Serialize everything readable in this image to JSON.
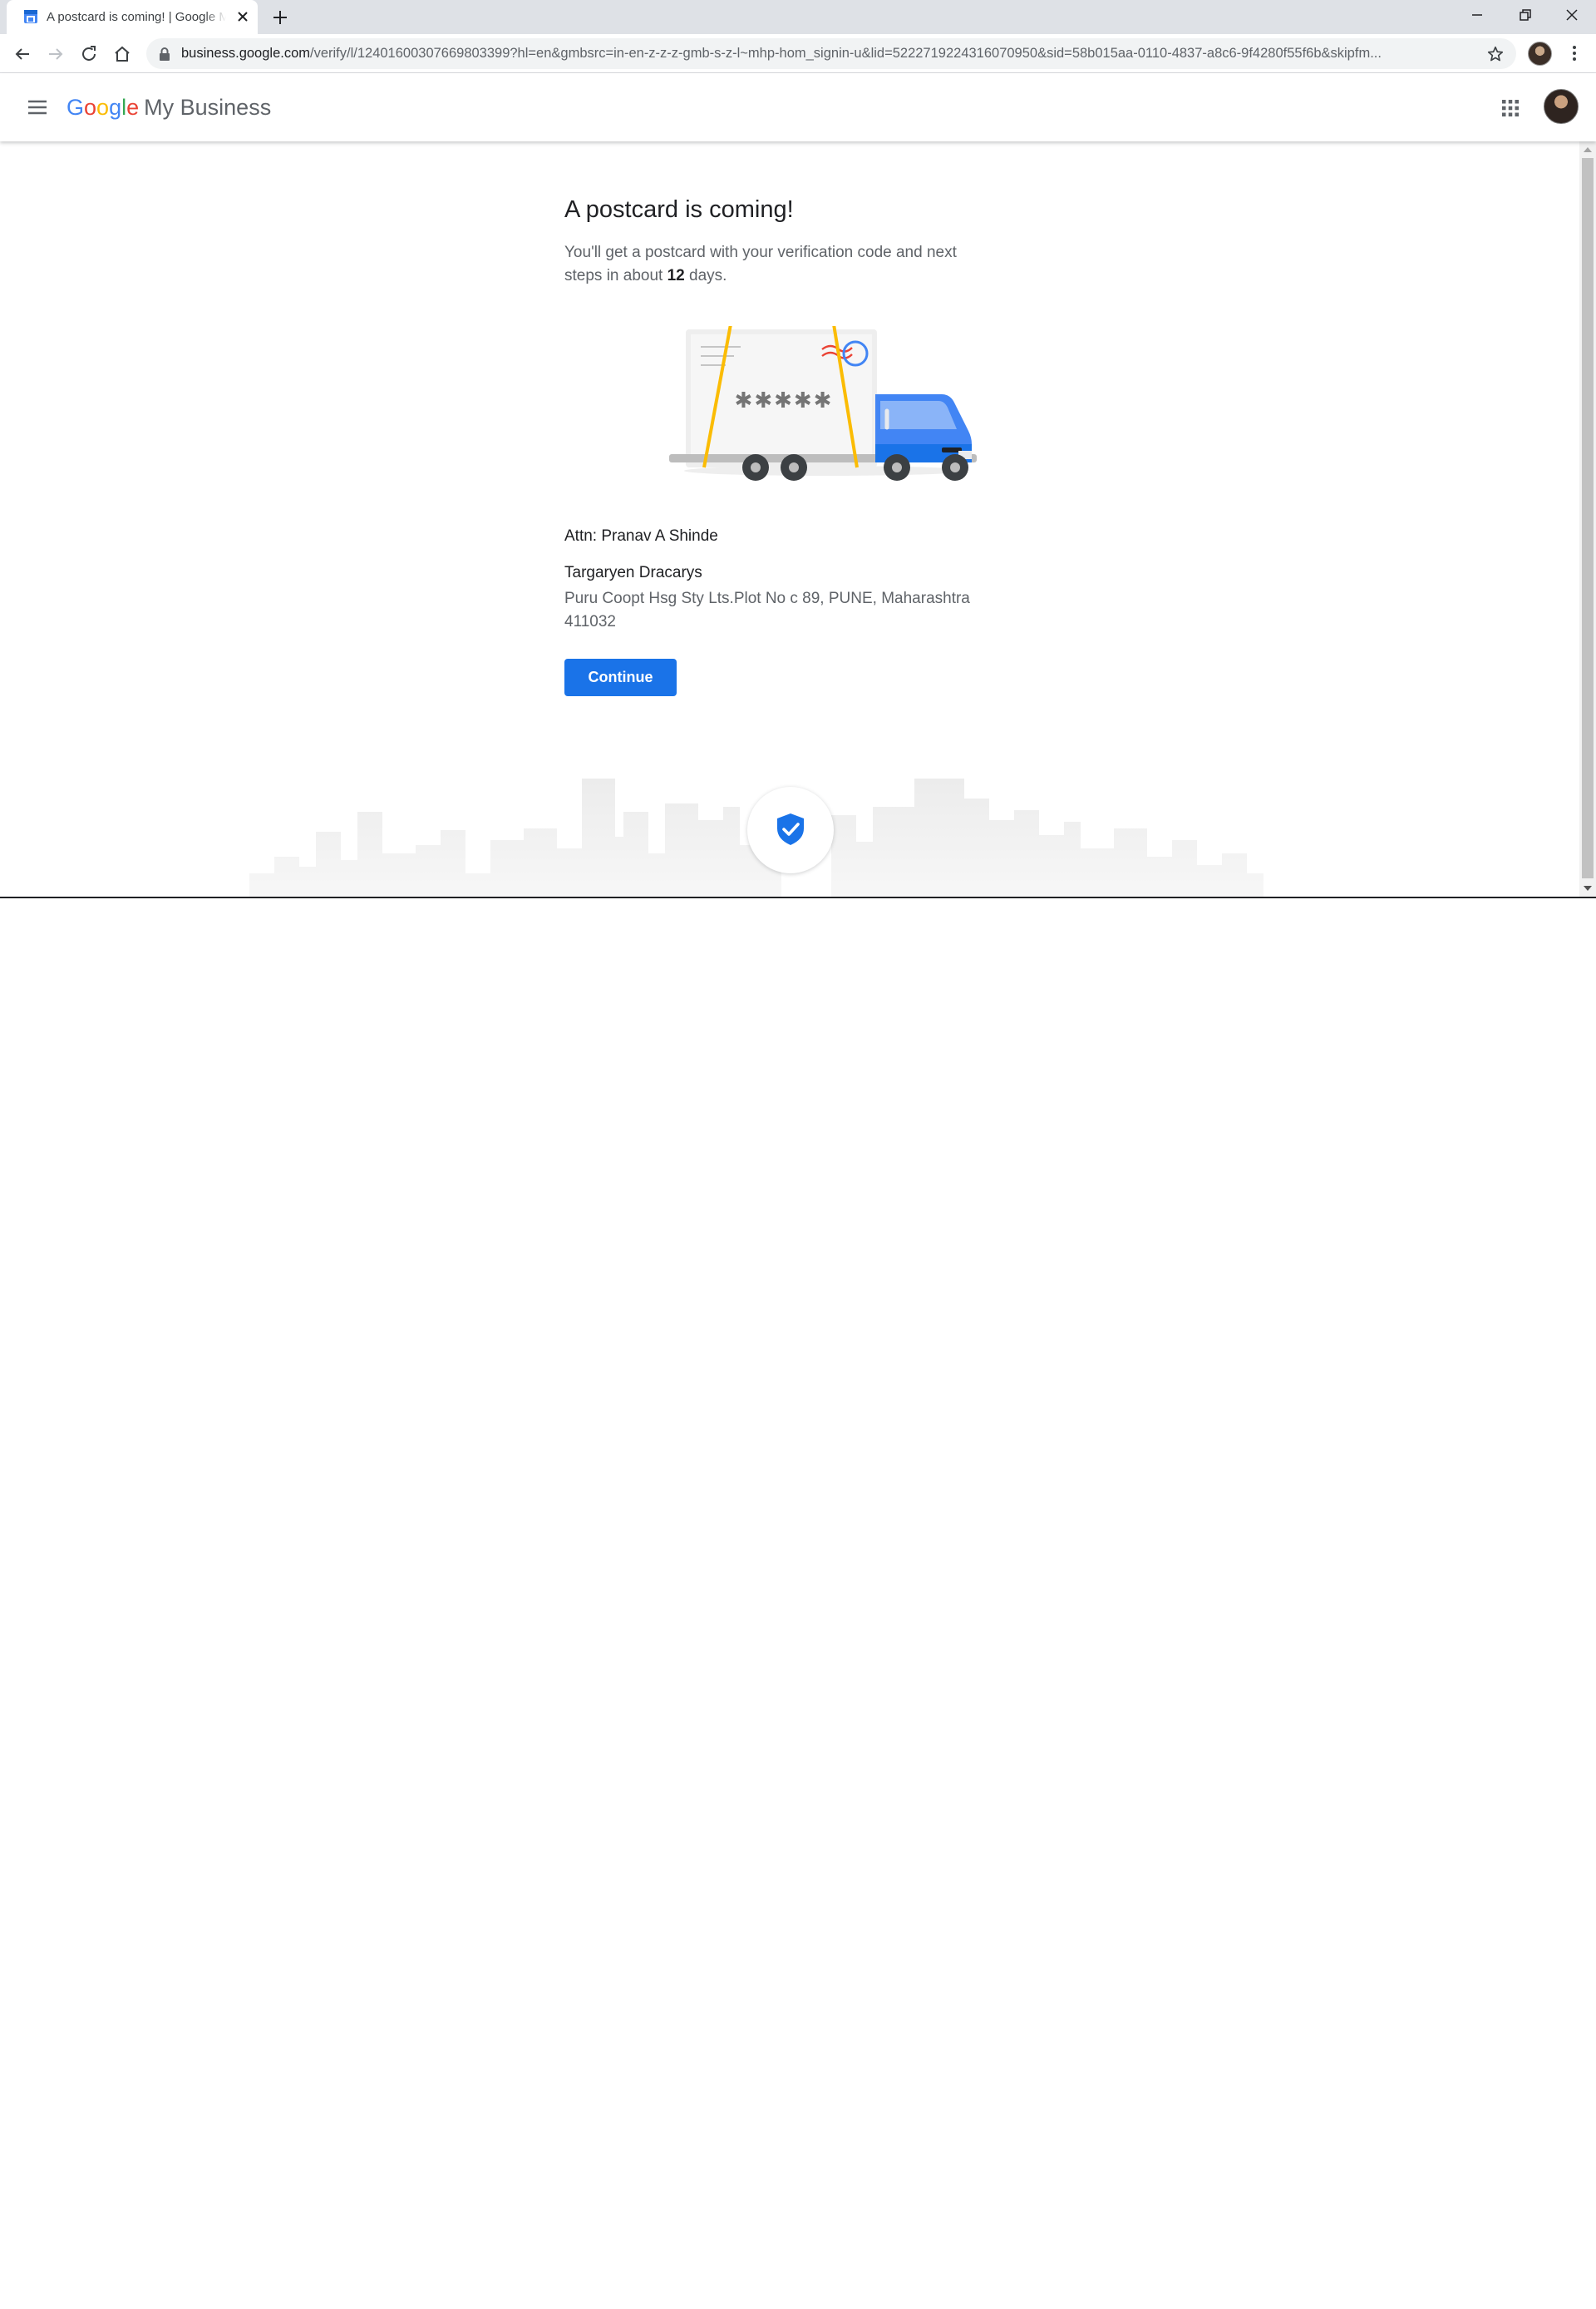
{
  "browser": {
    "tab_title": "A postcard is coming! | Google My Business",
    "url_domain": "business.google.com",
    "url_path": "/verify/l/12401600307669803399?hl=en&gmbsrc=in-en-z-z-z-gmb-s-z-l~mhp-hom_signin-u&lid=5222719224316070950&sid=58b015aa-0110-4837-a8c6-9f4280f55f6b&skipfm..."
  },
  "appbar": {
    "logo_letters": [
      "G",
      "o",
      "o",
      "g",
      "l",
      "e"
    ],
    "product_name": "My Business"
  },
  "main": {
    "heading": "A postcard is coming!",
    "subtext_before": "You'll get a postcard with your verification code and next steps in about ",
    "days": "12",
    "subtext_after": " days.",
    "postcard_code": "✱✱✱✱✱",
    "attn": "Attn: Pranav A Shinde",
    "business_name": "Targaryen Dracarys",
    "address": "Puru Coopt Hsg Sty Lts.Plot No c 89, PUNE, Maharashtra 411032",
    "continue_label": "Continue"
  },
  "colors": {
    "primary_blue": "#1a73e8",
    "truck_blue": "#4285f4",
    "strap_yellow": "#fbbc04"
  },
  "icons": {
    "favicon": "gmb-favicon",
    "shield": "verified-shield-icon"
  }
}
